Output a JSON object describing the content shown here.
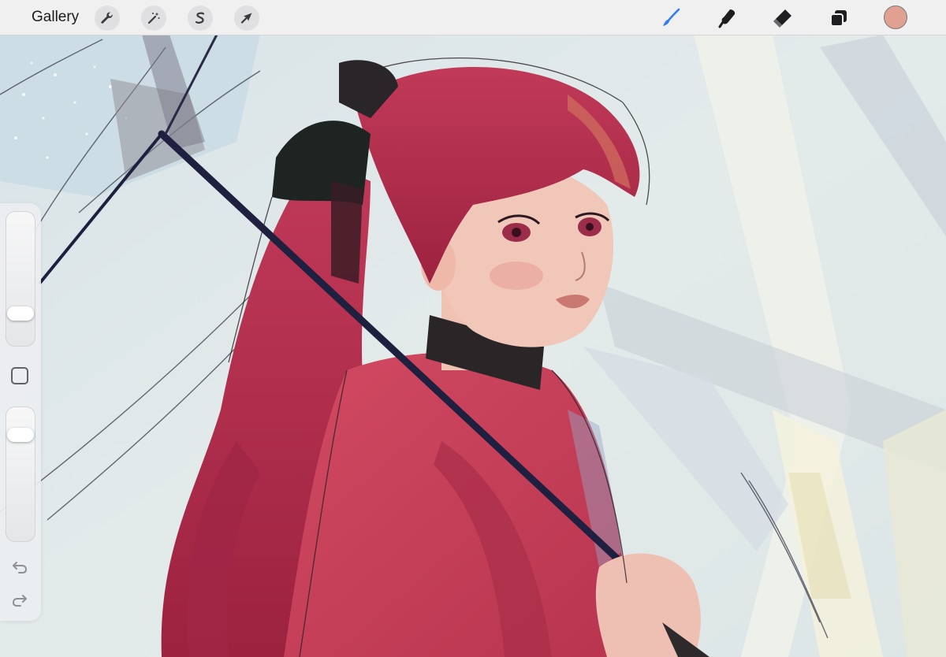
{
  "toolbar": {
    "gallery_label": "Gallery",
    "left_tools": [
      {
        "name": "actions",
        "icon": "wrench-icon"
      },
      {
        "name": "adjustments",
        "icon": "magic-wand-icon"
      },
      {
        "name": "selection",
        "icon": "selection-s-icon"
      },
      {
        "name": "transform",
        "icon": "arrow-cursor-icon"
      }
    ],
    "right_tools": [
      {
        "name": "brush",
        "icon": "brush-icon",
        "active": true
      },
      {
        "name": "smudge",
        "icon": "smudge-finger-icon"
      },
      {
        "name": "eraser",
        "icon": "eraser-icon"
      },
      {
        "name": "layers",
        "icon": "layers-icon"
      }
    ],
    "current_color": "#e0a190",
    "accent_color": "#2f7cf6"
  },
  "sidebar": {
    "brush_size_level": 0.2,
    "opacity_level": 0.84,
    "modify_button_icon": "square-outline-icon",
    "undo_icon": "undo-arrow-icon",
    "redo_icon": "redo-arrow-icon"
  },
  "canvas": {
    "subject": "sketch-painting",
    "palette": {
      "background": "#dfe8eb",
      "hair": "#b02a4a",
      "coat": "#c8405a",
      "skin": "#f0c2b6",
      "umbrella_shaft": "#1f1f3f"
    }
  }
}
